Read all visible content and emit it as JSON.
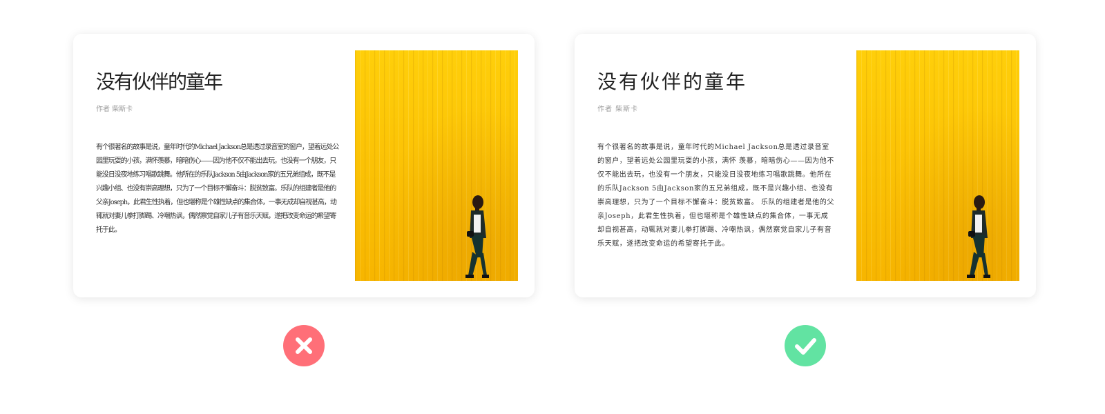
{
  "colors": {
    "bad": "#ff6f78",
    "good": "#62e3a2",
    "photo_yellow": "#ffc107"
  },
  "examples": [
    {
      "title": "没有伙伴的童年",
      "byline": "作者 柴斯卡",
      "body": "有个很著名的故事是说，童年时代的Michael Jackson总是透过录音室的窗户，望着远处公园里玩耍的小孩，满怀羡慕，暗暗伤心——因为他不仅不能出去玩，也没有一个朋友，只能没日没夜地练习唱歌跳舞。他所在的乐队Jackson 5由Jackson家的五兄弟组成，既不是兴趣小组、也没有崇高理想，只为了一个目标不懈奋斗：脱贫致富。乐队的组建者是他的父亲Joseph，此君生性执着，但也堪称是个雄性缺点的集合体，一事无成却自视甚高，动辄就对妻儿拳打脚踢、冷嘲热讽，偶然察觉自家儿子有音乐天赋，遂把改变命运的希望寄托于此。",
      "verdict_icon": "cross-icon"
    },
    {
      "title": "没有伙伴的童年",
      "byline": "作者 柴斯卡",
      "body": "有个很著名的故事是说，童年时代的Michael  Jackson总是透过录音室的窗户，望着远处公园里玩耍的小孩，满怀  羡慕，暗暗伤心——因为他不仅不能出去玩，也没有一个朋友，只能没日没夜地练习唱歌跳舞。他所在的乐队Jackson  5由Jackson家的五兄弟组成，既不是兴趣小组、也没有崇高理想，只为了一个目标不懈奋斗：脱贫致富。  乐队的组建者是他的父亲Joseph，此君生性执着，但也堪称是个雄性缺点的集合体，一事无成却自视甚高，动辄就对妻儿拳打脚踢、冷嘲热讽，偶然察觉自家儿子有音乐天赋，遂把改变命运的希望寄托于此。",
      "verdict_icon": "checkmark-icon"
    }
  ]
}
